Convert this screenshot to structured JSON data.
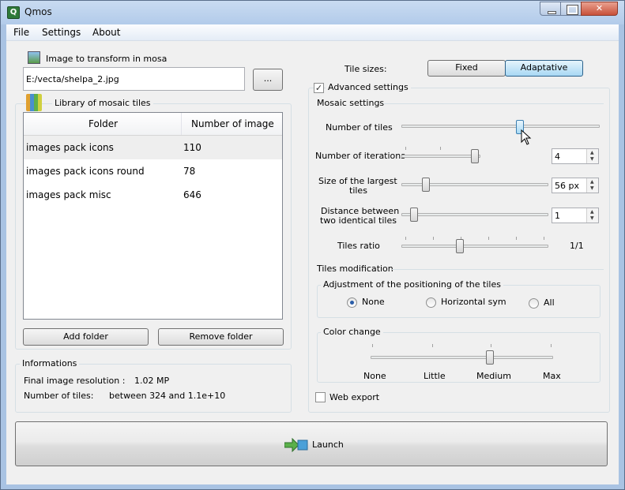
{
  "window": {
    "title": "Qmos"
  },
  "menu": {
    "file": "File",
    "settings": "Settings",
    "about": "About"
  },
  "image_group": {
    "label": "Image to transform in mosa",
    "path": "E:/vecta/shelpa_2.jpg",
    "browse": "..."
  },
  "library": {
    "label": "Library of mosaic tiles",
    "col_folder": "Folder",
    "col_count": "Number of image",
    "rows": [
      {
        "folder": "images pack icons",
        "count": "110"
      },
      {
        "folder": "images pack icons round",
        "count": "78"
      },
      {
        "folder": "images pack misc",
        "count": "646"
      }
    ],
    "add": "Add folder",
    "remove": "Remove folder"
  },
  "info": {
    "label": "Informations",
    "res_label": "Final image resolution :",
    "res_value": "1.02 MP",
    "tiles_label": "Number of tiles:",
    "tiles_value": "between 324 and 1.1e+10"
  },
  "tile_sizes": {
    "label": "Tile sizes:",
    "fixed": "Fixed",
    "adaptative": "Adaptative",
    "selected": "Adaptative"
  },
  "advanced": {
    "label": "Advanced settings",
    "checked": true
  },
  "mosaic": {
    "label": "Mosaic settings",
    "num_tiles": {
      "label": "Number of tiles",
      "level": 0.6
    },
    "iterations": {
      "label": "Number of iterations",
      "value": "4",
      "level": 0.7
    },
    "largest": {
      "label1": "Size of the largest",
      "label2": "tiles",
      "value": "56 px",
      "level": 0.15
    },
    "distance": {
      "label1": "Distance between",
      "label2": "two identical tiles",
      "value": "1",
      "level": 0.05
    },
    "ratio": {
      "label": "Tiles ratio",
      "value": "1/1",
      "level": 0.4
    }
  },
  "tiles_mod": {
    "label": "Tiles modification",
    "positioning": {
      "label": "Adjustment of the positioning of the tiles",
      "options": [
        "None",
        "Horizontal sym",
        "All"
      ],
      "selected": "None"
    },
    "color": {
      "label": "Color change",
      "ticks": [
        "None",
        "Little",
        "Medium",
        "Max"
      ],
      "selected": "Medium"
    }
  },
  "web_export": {
    "label": "Web export",
    "checked": false
  },
  "launch": "Launch"
}
